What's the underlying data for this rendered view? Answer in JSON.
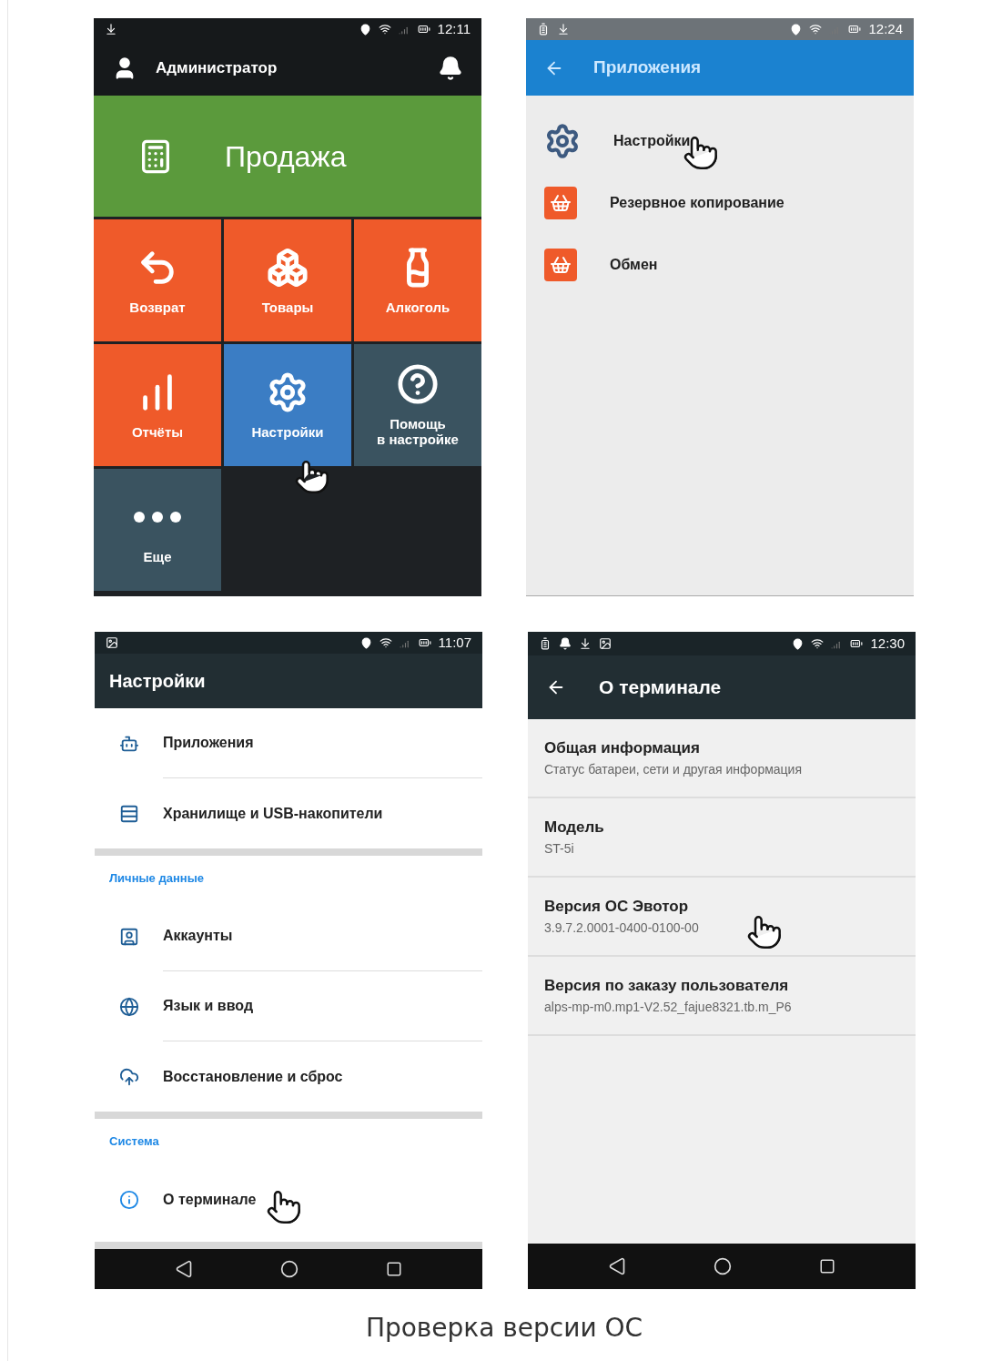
{
  "home": {
    "time": "12:11",
    "user": "Администратор",
    "sale": "Продажа",
    "tiles": [
      {
        "label": "Возврат",
        "kind": "return",
        "color": "#ef5a2a"
      },
      {
        "label": "Товары",
        "kind": "goods",
        "color": "#ef5a2a"
      },
      {
        "label": "Алкоголь",
        "kind": "alcohol",
        "color": "#ef5a2a"
      },
      {
        "label": "Отчёты",
        "kind": "reports",
        "color": "#ef5a2a"
      },
      {
        "label": "Настройки",
        "kind": "settings",
        "color": "#3b7dc4"
      },
      {
        "label": "Помощь\nв настройке",
        "kind": "help",
        "color": "#3a5360"
      },
      {
        "label": "Еще",
        "kind": "more",
        "color": "#3a5360"
      }
    ]
  },
  "apps": {
    "time": "12:24",
    "title": "Приложения",
    "items": [
      {
        "label": "Настройки",
        "kind": "gear"
      },
      {
        "label": "Резервное копирование",
        "kind": "basket"
      },
      {
        "label": "Обмен",
        "kind": "basket"
      }
    ]
  },
  "settings": {
    "time": "11:07",
    "title": "Настройки",
    "sections": [
      {
        "items": [
          {
            "label": "Приложения",
            "kind": "android"
          },
          {
            "label": "Хранилище и USB-накопители",
            "kind": "storage"
          }
        ]
      },
      {
        "header": "Личные данные",
        "items": [
          {
            "label": "Аккаунты",
            "kind": "account"
          },
          {
            "label": "Язык и ввод",
            "kind": "language"
          },
          {
            "label": "Восстановление и сброс",
            "kind": "restore"
          }
        ]
      },
      {
        "header": "Система",
        "items": [
          {
            "label": "О терминале",
            "kind": "info"
          }
        ]
      }
    ]
  },
  "about": {
    "time": "12:30",
    "title": "О терминале",
    "items": [
      {
        "title": "Общая информация",
        "subtitle": "Статус батареи, сети и другая информация"
      },
      {
        "title": "Модель",
        "subtitle": "ST-5i"
      },
      {
        "title": "Версия ОС Эвотор",
        "subtitle": "3.9.7.2.0001-0400-0100-00"
      },
      {
        "title": "Версия по заказу пользователя",
        "subtitle": "alps-mp-m0.mp1-V2.52_fajue8321.tb.m_P6"
      }
    ]
  },
  "caption": "Проверка версии ОС"
}
